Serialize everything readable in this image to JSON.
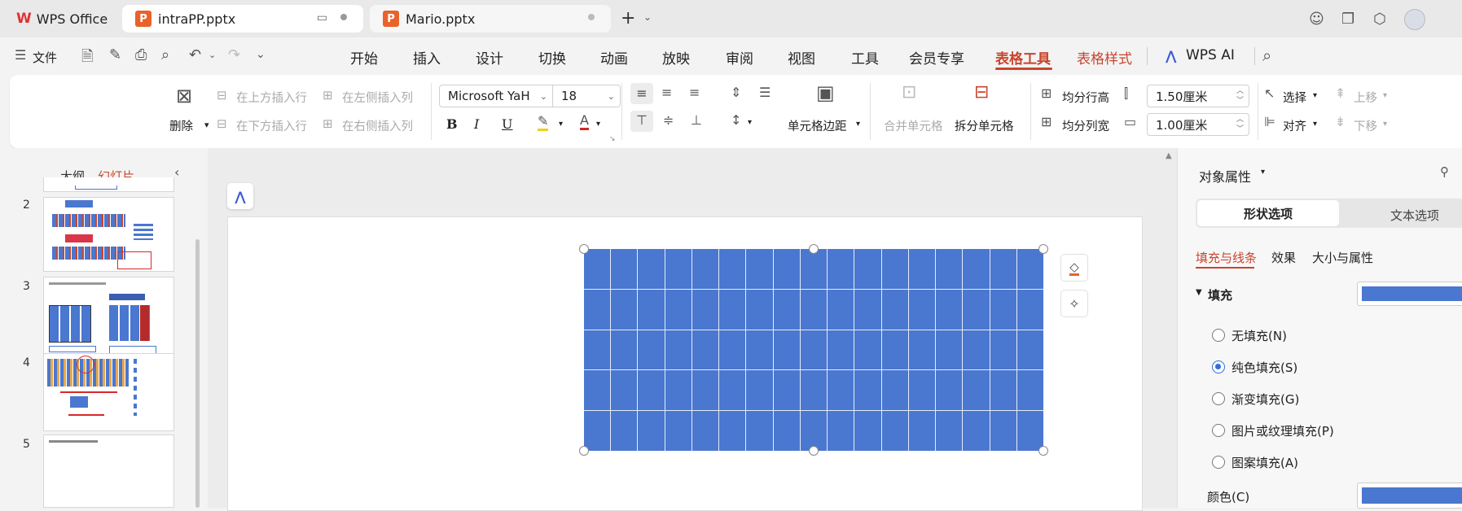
{
  "tabs": [
    {
      "label": "WPS Office"
    },
    {
      "label": "intraPP.pptx"
    },
    {
      "label": "Mario.pptx"
    }
  ],
  "menu": {
    "file": "文件",
    "items": [
      "开始",
      "插入",
      "设计",
      "切换",
      "动画",
      "放映",
      "审阅",
      "视图",
      "工具",
      "会员专享",
      "表格工具",
      "表格样式",
      "WPS AI"
    ],
    "active": "表格工具"
  },
  "ribbon": {
    "delete": "删除",
    "insert_above": "在上方插入行",
    "insert_below": "在下方插入行",
    "insert_left": "在左侧插入列",
    "insert_right": "在右侧插入列",
    "font_name": "Microsoft YaH",
    "font_size": "18",
    "bold": "B",
    "italic": "I",
    "underline": "U",
    "cell_margin": "单元格边距",
    "merge": "合并单元格",
    "split": "拆分单元格",
    "row_height_even": "均分行高",
    "col_width_even": "均分列宽",
    "row_height_value": "1.50厘米",
    "col_width_value": "1.00厘米",
    "select": "选择",
    "align": "对齐",
    "move_up": "上移",
    "move_down": "下移"
  },
  "left_panel": {
    "outline_tab": "大纲",
    "slides_tab": "幻灯片",
    "slide_numbers": [
      "2",
      "3",
      "4",
      "5"
    ]
  },
  "table": {
    "rows": 5,
    "cols": 17,
    "color": "#4a77cf"
  },
  "right_panel": {
    "title": "对象属性",
    "tab_shape": "形状选项",
    "tab_text": "文本选项",
    "sub_fill_line": "填充与线条",
    "sub_effect": "效果",
    "sub_size": "大小与属性",
    "fill_section": "填充",
    "options": [
      "无填充(N)",
      "纯色填充(S)",
      "渐变填充(G)",
      "图片或纹理填充(P)",
      "图案填充(A)"
    ],
    "selected_option": "纯色填充(S)",
    "color_label": "颜色(C)",
    "fill_color": "#4a77cf"
  },
  "colors": {
    "accent": "#c8452e",
    "table_blue": "#4a77cf"
  }
}
